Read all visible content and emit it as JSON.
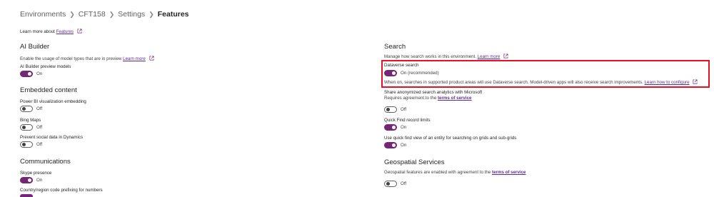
{
  "breadcrumb": {
    "items": [
      "Environments",
      "CFT158",
      "Settings"
    ],
    "current": "Features"
  },
  "intro": {
    "text": "Learn more about",
    "link": "Features"
  },
  "ai_builder": {
    "heading": "AI Builder",
    "description": "Enable the usage of model types that are in preview",
    "learn_more": "Learn more",
    "preview_models": {
      "label": "AI Builder preview models",
      "state": "On"
    }
  },
  "embedded": {
    "heading": "Embedded content",
    "powerbi": {
      "label": "Power BI visualization embedding",
      "state": "Off"
    },
    "bing": {
      "label": "Bing Maps",
      "state": "Off"
    },
    "social": {
      "label": "Prevent social data in Dynamics",
      "state": "Off"
    }
  },
  "communications": {
    "heading": "Communications",
    "skype": {
      "label": "Skype presence",
      "state": "On"
    },
    "country_code": {
      "label": "Country/region code prefixing for numbers"
    }
  },
  "search": {
    "heading": "Search",
    "description": "Manage how search works in this environment.",
    "learn_more": "Learn more",
    "dataverse": {
      "label": "Dataverse search",
      "state": "On (recommended)",
      "note": "When on, searches in supported product areas will use Dataverse search. Model-driven apps will also receive search improvements.",
      "configure_link": "Learn how to configure"
    },
    "analytics": {
      "label": "Share anonymized search analytics with Microsoft",
      "requires": "Requires agreement to the",
      "terms_link": "terms of service",
      "state": "Off"
    },
    "quick_find": {
      "label": "Quick Find record limits",
      "state": "On"
    },
    "quick_view": {
      "label": "Use quick find view of an entity for searching on grids and sub-grids",
      "state": "On"
    }
  },
  "geospatial": {
    "heading": "Geospatial Services",
    "description": "Geospatial features are enabled with agreement to the",
    "terms_link": "terms of service",
    "state": "Off"
  },
  "colors": {
    "accent": "#742774",
    "link": "#5c2d91",
    "highlight": "#e81123"
  },
  "icons": {
    "external": "external-link-icon",
    "chevron": "chevron-right-icon"
  }
}
